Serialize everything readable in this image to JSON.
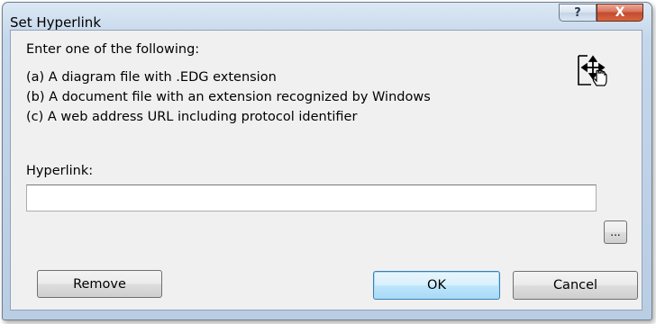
{
  "window": {
    "title": "Set Hyperlink",
    "help_glyph": "?",
    "close_glyph": "X"
  },
  "content": {
    "instructions": "Enter one of the following:",
    "options": [
      "(a)  A diagram file with .EDG extension",
      "(b)  A document file with an extension recognized by Windows",
      "(c)  A web address URL including protocol identifier"
    ],
    "hyperlink_label": "Hyperlink:",
    "hyperlink_value": ""
  },
  "icons": {
    "drag": "hyperlink-drag-hand-icon"
  },
  "buttons": {
    "browse": "...",
    "remove": "Remove",
    "ok": "OK",
    "cancel": "Cancel"
  },
  "colors": {
    "frame": "#b9cde3",
    "close_button": "#c24a2f",
    "default_button": "#bee6fd"
  }
}
